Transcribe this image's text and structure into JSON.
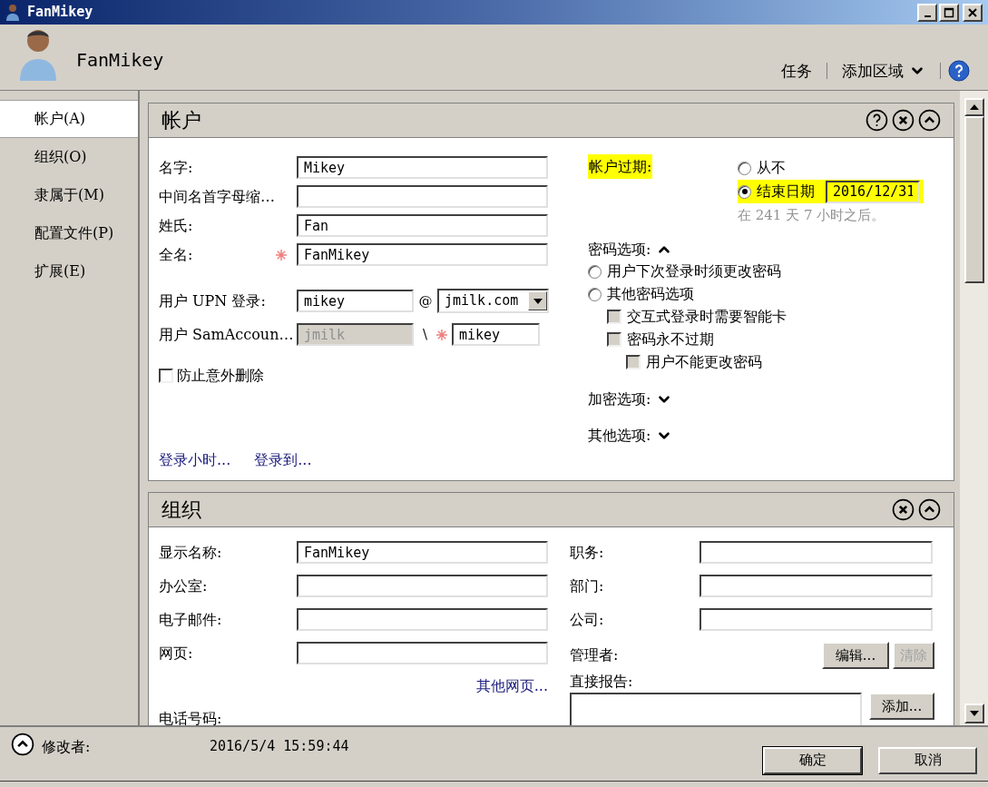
{
  "window": {
    "title": "FanMikey"
  },
  "header": {
    "name": "FanMikey",
    "links": [
      {
        "label": "任务",
        "dropdown": false
      },
      {
        "label": "添加区域",
        "dropdown": true
      }
    ]
  },
  "nav": [
    {
      "label": "帐户(A)",
      "selected": true
    },
    {
      "label": "组织(O)",
      "selected": false
    },
    {
      "label": "隶属于(M)",
      "selected": false
    },
    {
      "label": "配置文件(P)",
      "selected": false
    },
    {
      "label": "扩展(E)",
      "selected": false
    }
  ],
  "account": {
    "title": "帐户",
    "actions": [
      {
        "kind": "help"
      },
      {
        "kind": "close"
      },
      {
        "kind": "collapse"
      }
    ],
    "fields": [
      {
        "label": "名字:",
        "value": "Mikey",
        "required": false
      },
      {
        "label": "中间名首字母缩…",
        "required": false
      },
      {
        "label": "姓氏:",
        "value": "Fan",
        "required": false
      },
      {
        "label": "全名:",
        "value": "FanMikey",
        "required": true
      }
    ],
    "upn": {
      "label": "用户 UPN 登录:",
      "value": "mikey",
      "at": "@",
      "domain": "jmilk.com"
    },
    "sam": {
      "label": "用户 SamAccoun…",
      "domain": "jmilk",
      "domain_disabled": true,
      "separator": "\\",
      "value": "mikey",
      "required": true
    },
    "protect": {
      "label": "防止意外删除",
      "checked": false
    },
    "links": [
      "登录小时...",
      "登录到..."
    ],
    "expiry": {
      "label": "帐户过期:",
      "highlighted": true,
      "options": [
        {
          "label": "从不",
          "selected": false,
          "highlighted": false
        },
        {
          "label": "结束日期",
          "selected": true,
          "highlighted": true,
          "date": "2016/12/31"
        }
      ],
      "note": "在 241 天 7 小时之后。"
    },
    "password": {
      "label": "密码选项:",
      "expanded": true,
      "options": [
        {
          "kind": "radio",
          "label": "用户下次登录时须更改密码",
          "selected": false
        },
        {
          "kind": "radio",
          "label": "其他密码选项",
          "selected": false,
          "children": [
            {
              "kind": "checkbox",
              "label": "交互式登录时需要智能卡",
              "checked": false,
              "disabled": true
            },
            {
              "kind": "checkbox",
              "label": "密码永不过期",
              "checked": false,
              "disabled": true,
              "children": [
                {
                  "kind": "checkbox",
                  "label": "用户不能更改密码",
                  "checked": false,
                  "disabled": true
                }
              ]
            }
          ]
        }
      ]
    },
    "sections": [
      {
        "label": "加密选项:",
        "expanded": false
      },
      {
        "label": "其他选项:",
        "expanded": false
      }
    ]
  },
  "organization": {
    "title": "组织",
    "actions": [
      {
        "kind": "close"
      },
      {
        "kind": "collapse"
      }
    ],
    "left": [
      {
        "label": "显示名称:",
        "value": "FanMikey"
      },
      {
        "label": "办公室:"
      },
      {
        "label": "电子邮件:"
      },
      {
        "label": "网页:"
      }
    ],
    "more_link": "其他网页...",
    "phone_label": "电话号码:",
    "right": [
      {
        "label": "职务:"
      },
      {
        "label": "部门:"
      },
      {
        "label": "公司:"
      }
    ],
    "manager": {
      "label": "管理者:",
      "buttons": [
        {
          "label": "编辑...",
          "disabled": false
        },
        {
          "label": "清除",
          "disabled": true
        }
      ]
    },
    "reports": {
      "label": "直接报告:",
      "button": "添加..."
    }
  },
  "footer": {
    "label": "修改者:",
    "value": "2016/5/4 15:59:44",
    "buttons": [
      {
        "label": "确定",
        "default": true
      },
      {
        "label": "取消",
        "default": false
      }
    ]
  }
}
